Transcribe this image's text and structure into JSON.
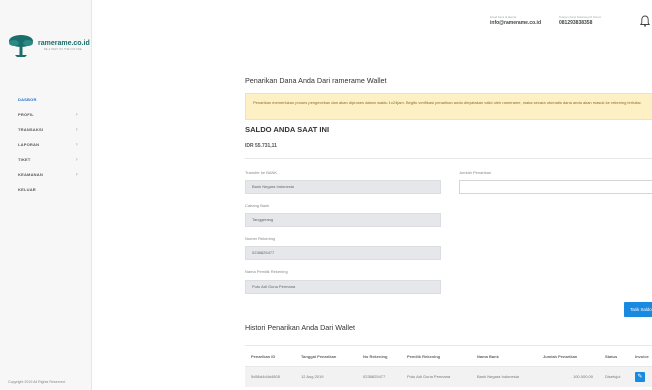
{
  "brand": {
    "name": "ramerame.co.id",
    "tagline": "BE A PART OF THE FUTURE"
  },
  "sidebar": {
    "items": [
      {
        "label": "DASBOR",
        "active": true,
        "has_chevron": false
      },
      {
        "label": "PROFIL",
        "active": false,
        "has_chevron": true
      },
      {
        "label": "TRANSAKSI",
        "active": false,
        "has_chevron": true
      },
      {
        "label": "LAPORAN",
        "active": false,
        "has_chevron": true
      },
      {
        "label": "TIKET",
        "active": false,
        "has_chevron": true
      },
      {
        "label": "KEAMANAN",
        "active": false,
        "has_chevron": true
      },
      {
        "label": "KELUAR",
        "active": false,
        "has_chevron": false
      }
    ],
    "copyright": "Copyright 2019 All Rights Reserved."
  },
  "topbar": {
    "email_label": "Email Kami di alamat",
    "email": "info@ramerame.co.id",
    "phone_label": "Telepon Kami Sekarang Di Nomor",
    "phone": "081293838358",
    "icon": "bell-icon"
  },
  "main": {
    "title": "Penarikan Dana Anda Dari ramerame Wallet",
    "alert": "Penarikan memerlukan proses pengecekan dan akan diproses dalam waktu 1x24jam. Begitu verifikasi penarikan anda dinyatakan valid oleh ramerame, maka secara otomatis dana anda akan masuk ke rekening tertuliar.",
    "balance_heading": "SALDO ANDA SAAT INI",
    "balance_value": "IDR 55.731,11",
    "form": {
      "bank_label": "Transfer ke BANK",
      "bank_value": "Bank Negara Indonesia",
      "branch_label": "Cabang Bank",
      "branch_value": "Tanggerang",
      "account_label": "Nomer Rekening",
      "account_value": "0238825477",
      "owner_label": "Nama Pemilik Rekening",
      "owner_value": "Putu Adi Guna Permana",
      "amount_label": "Jumlah Penarikan",
      "amount_value": "",
      "submit_label": "Tarik Saldo"
    },
    "history": {
      "title": "Histori Penarikan Anda Dari Wallet",
      "columns": [
        "Penarikan ID",
        "Tanggal Penarikan",
        "No Rekening",
        "Pemilik Rekening",
        "Nama Bank",
        "Jumlah Penarikan",
        "Status",
        "Invoice"
      ],
      "rows": [
        [
          "5d56d4d4d4805",
          "12 Aug 2019",
          "0238825477",
          "Putu Adi Guna Permana",
          "Bank Negara Indonesia",
          "100.000,00",
          "Disetujui",
          ""
        ]
      ]
    }
  },
  "colors": {
    "accent": "#1a8ae0",
    "active_nav": "#1a6fd1",
    "brand_teal": "#1b6e6a",
    "alert_bg": "#fdf0c4"
  }
}
